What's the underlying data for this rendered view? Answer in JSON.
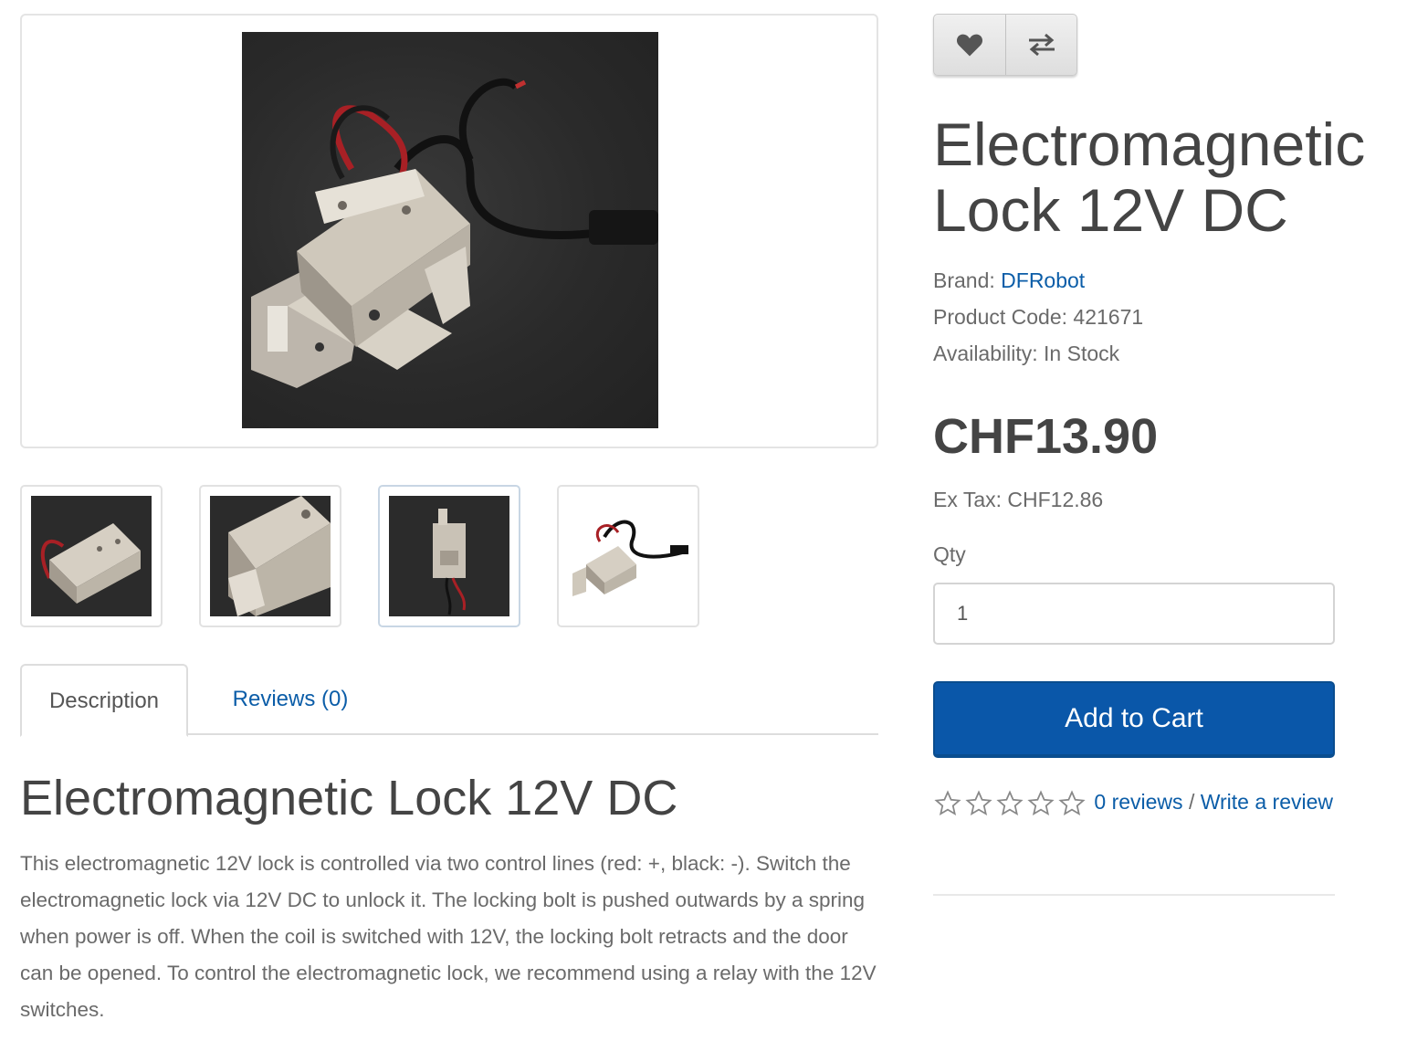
{
  "product": {
    "title": "Electromagnetic Lock 12V DC",
    "brand_label": "Brand:",
    "brand": "DFRobot",
    "code_label": "Product Code:",
    "code": "421671",
    "availability_label": "Availability:",
    "availability": "In Stock",
    "price": "CHF13.90",
    "ex_tax_label": "Ex Tax:",
    "ex_tax": "CHF12.86"
  },
  "actions": {
    "wishlist_icon": "heart-icon",
    "compare_icon": "compare-arrows-icon",
    "qty_label": "Qty",
    "qty_value": "1",
    "add_to_cart": "Add to Cart"
  },
  "rating": {
    "stars_filled": 0,
    "stars_total": 5,
    "reviews_link": "0 reviews",
    "separator": "/",
    "write_review": "Write a review"
  },
  "tabs": [
    {
      "label": "Description",
      "active": true
    },
    {
      "label": "Reviews (0)",
      "active": false
    }
  ],
  "description": {
    "heading": "Electromagnetic Lock 12V DC",
    "text": "This electromagnetic 12V lock is controlled via two control lines (red: +, black: -). Switch the electromagnetic lock via 12V DC to unlock it. The locking bolt is pushed outwards by a spring when power is off. When the coil is switched with 12V, the locking bolt retracts and the door can be opened. To control the electromagnetic lock, we recommend using a relay with the 12V switches."
  },
  "colors": {
    "accent": "#0a57a9",
    "link": "#0b5da8",
    "text": "#444444",
    "muted": "#6a6a6a"
  }
}
